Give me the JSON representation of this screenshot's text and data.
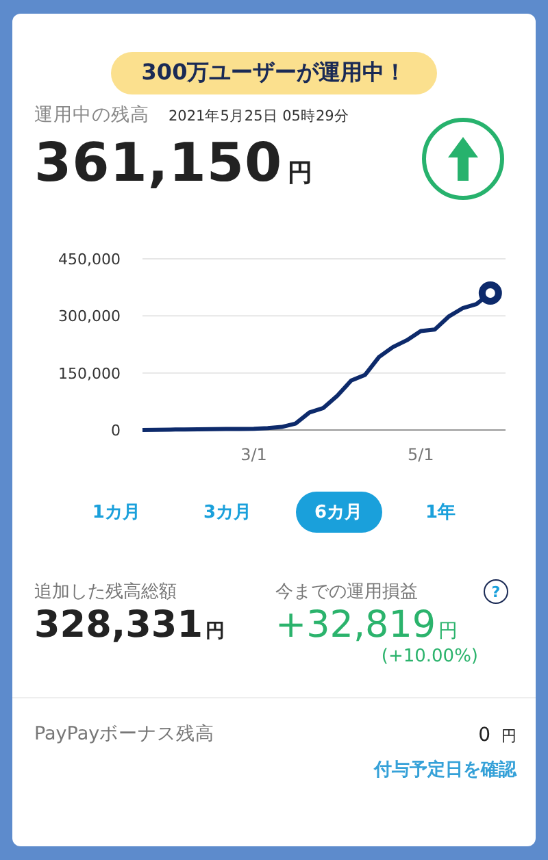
{
  "banner": "300万ユーザーが運用中！",
  "balance": {
    "label": "運用中の残高",
    "timestamp": "2021年5月25日 05時29分",
    "amount": "361,150",
    "unit": "円"
  },
  "chart_data": {
    "type": "line",
    "categories": [
      null,
      null,
      null,
      null,
      null,
      null,
      null,
      null,
      "3/1",
      null,
      null,
      null,
      null,
      null,
      null,
      null,
      null,
      null,
      null,
      null,
      "5/1",
      null,
      null,
      null,
      null,
      null
    ],
    "series": [
      {
        "color": "#0d2a6b",
        "values": [
          0,
          500,
          1000,
          1500,
          2000,
          2200,
          2500,
          2800,
          3000,
          5000,
          8000,
          17000,
          46000,
          58000,
          90000,
          130000,
          145000,
          192000,
          218000,
          236000,
          260000,
          264000,
          298000,
          320000,
          331000,
          360000
        ]
      }
    ],
    "ylim": [
      0,
      450000
    ],
    "yticks": [
      {
        "value": 0,
        "label": "0"
      },
      {
        "value": 150000,
        "label": "150,000"
      },
      {
        "value": 300000,
        "label": "300,000"
      },
      {
        "value": 450000,
        "label": "450,000"
      }
    ]
  },
  "periods": [
    {
      "label": "1カ月",
      "selected": false
    },
    {
      "label": "3カ月",
      "selected": false
    },
    {
      "label": "6カ月",
      "selected": true
    },
    {
      "label": "1年",
      "selected": false
    }
  ],
  "added": {
    "label": "追加した残高総額",
    "amount": "328,331",
    "unit": "円"
  },
  "profit": {
    "label": "今までの運用損益",
    "amount": "+32,819",
    "unit": "円",
    "percent": "(+10.00%)",
    "help": "?"
  },
  "bonus": {
    "label": "PayPayボーナス残高",
    "amount": "0",
    "unit": "円",
    "link": "付与予定日を確認"
  }
}
